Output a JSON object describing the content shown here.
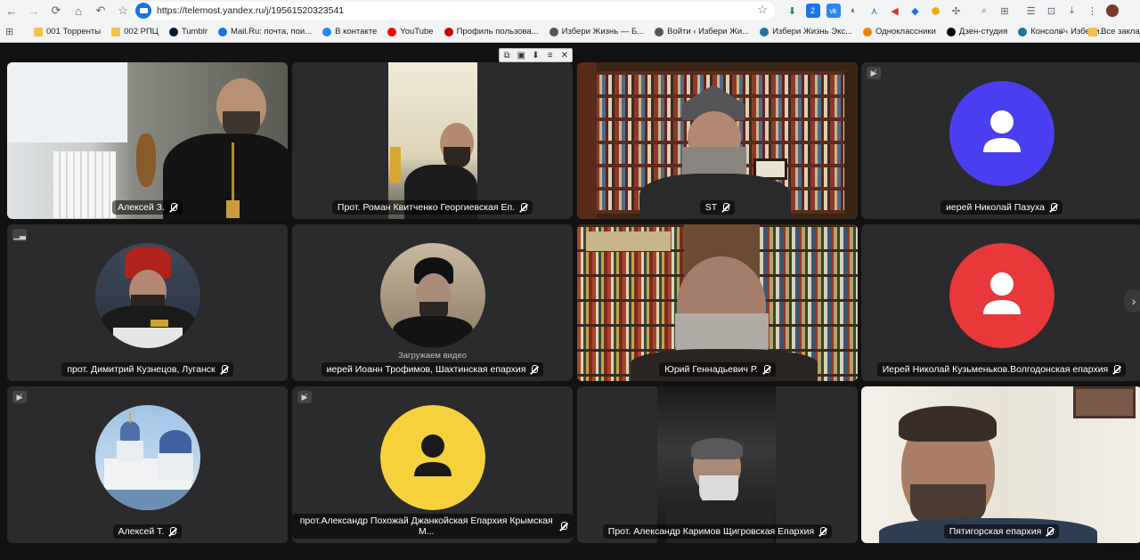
{
  "browser": {
    "url": "https://telemost.yandex.ru/j/19561520323541",
    "nav": {
      "back_icon": "arrow-left",
      "forward_icon": "arrow-right",
      "reload_icon": "reload",
      "home_icon": "home",
      "undo_icon": "undo",
      "bookmark_icon": "star"
    },
    "bookmarks": [
      {
        "label": "001 Торренты",
        "icon": "folder",
        "color": "#f2c24d"
      },
      {
        "label": "002 РПЦ",
        "icon": "folder",
        "color": "#f2c24d"
      },
      {
        "label": "Tumblr",
        "icon": "tumblr",
        "color": "#001935"
      },
      {
        "label": "Mail.Ru: почта, пои...",
        "icon": "mailru",
        "color": "#1a73e8"
      },
      {
        "label": "В контакте",
        "icon": "vk",
        "color": "#2787f5"
      },
      {
        "label": "YouTube",
        "icon": "youtube",
        "color": "#ff0000"
      },
      {
        "label": "Профиль пользова...",
        "icon": "profile",
        "color": "#cc0000"
      },
      {
        "label": "Избери Жизнь — Б...",
        "icon": "globe",
        "color": "#555555"
      },
      {
        "label": "Войти ‹ Избери Жи...",
        "icon": "globe",
        "color": "#555555"
      },
      {
        "label": "Избери Жизнь Экс...",
        "icon": "wordpress",
        "color": "#21759b"
      },
      {
        "label": "Одноклассники",
        "icon": "ok",
        "color": "#ee8208"
      },
      {
        "label": "Дзен-студия",
        "icon": "zen",
        "color": "#000000"
      },
      {
        "label": "Консоль ‹ Избери...",
        "icon": "wordpress",
        "color": "#21759b"
      }
    ],
    "more_bookmarks": "»",
    "all_bookmarks": "Все закладки",
    "extension_badge": "2"
  },
  "meeting": {
    "loading_text": "Загружаем видео",
    "participants": [
      {
        "name": "Алексей З.",
        "mode": "video",
        "scene": "room-window"
      },
      {
        "name": "Прот. Роман Квитченко Георгиевская Еп.",
        "mode": "video",
        "scene": "narrow-phone"
      },
      {
        "name": "ST",
        "mode": "video",
        "scene": "library",
        "active": true
      },
      {
        "name": "иерей Николай Пазуха",
        "mode": "avatar",
        "avatar_color": "#4a3ff0",
        "camera_off": true
      },
      {
        "name": "прот. Димитрий Кузнецов, Луганск",
        "mode": "photo",
        "signal": true
      },
      {
        "name": "иерей Иоанн Трофимов, Шахтинская епархия",
        "mode": "photo",
        "loading": true
      },
      {
        "name": "Юрий Геннадьевич Р.",
        "mode": "video",
        "scene": "bookcase"
      },
      {
        "name": "Иерей Николай Кузьменьков.Волгодонская епархия",
        "mode": "avatar",
        "avatar_color": "#e8383a"
      },
      {
        "name": "Алексей Т.",
        "mode": "photo",
        "camera_off": true,
        "scene": "church"
      },
      {
        "name": "прот.Александр Похожай Джанкойская Епархия Крымская М...",
        "mode": "avatar",
        "avatar_color": "#f7d13c",
        "camera_off": true
      },
      {
        "name": "Прот. Александр Каримов Щигровская Епархия",
        "mode": "video",
        "scene": "car"
      },
      {
        "name": "Пятигорская епархия",
        "mode": "video",
        "scene": "bright-room"
      }
    ]
  },
  "floating_controls": [
    "pip-icon",
    "fullscreen-icon",
    "download-icon",
    "menu-icon",
    "close-icon"
  ],
  "next_page_icon": "chevron-right"
}
